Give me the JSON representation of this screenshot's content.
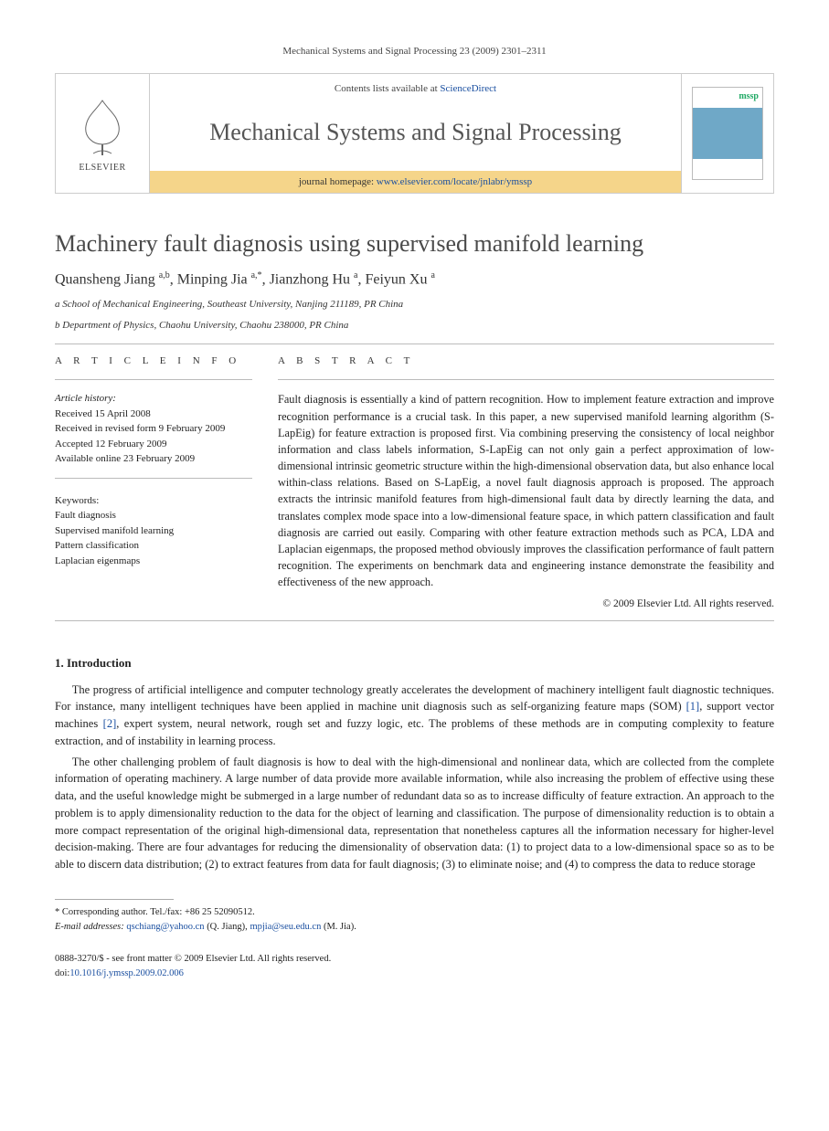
{
  "running_head": "Mechanical Systems and Signal Processing 23 (2009) 2301–2311",
  "header": {
    "contents_prefix": "Contents lists available at ",
    "contents_link": "ScienceDirect",
    "journal_name": "Mechanical Systems and Signal Processing",
    "homepage_prefix": "journal homepage: ",
    "homepage_link": "www.elsevier.com/locate/jnlabr/ymssp",
    "publisher_label": "ELSEVIER",
    "cover_label": "mssp"
  },
  "title": "Machinery fault diagnosis using supervised manifold learning",
  "authors_html": "Quansheng Jiang <sup>a,b</sup>, Minping Jia <sup>a,*</sup>, Jianzhong Hu <sup>a</sup>, Feiyun Xu <sup>a</sup>",
  "affiliations": {
    "a": "a School of Mechanical Engineering, Southeast University, Nanjing 211189, PR China",
    "b": "b Department of Physics, Chaohu University, Chaohu 238000, PR China"
  },
  "article_info": {
    "heading": "A R T I C L E   I N F O",
    "history_label": "Article history:",
    "received": "Received 15 April 2008",
    "revised": "Received in revised form 9 February 2009",
    "accepted": "Accepted 12 February 2009",
    "online": "Available online 23 February 2009",
    "keywords_label": "Keywords:",
    "keywords": [
      "Fault diagnosis",
      "Supervised manifold learning",
      "Pattern classification",
      "Laplacian eigenmaps"
    ]
  },
  "abstract": {
    "heading": "A B S T R A C T",
    "text": "Fault diagnosis is essentially a kind of pattern recognition. How to implement feature extraction and improve recognition performance is a crucial task. In this paper, a new supervised manifold learning algorithm (S-LapEig) for feature extraction is proposed first. Via combining preserving the consistency of local neighbor information and class labels information, S-LapEig can not only gain a perfect approximation of low-dimensional intrinsic geometric structure within the high-dimensional observation data, but also enhance local within-class relations. Based on S-LapEig, a novel fault diagnosis approach is proposed. The approach extracts the intrinsic manifold features from high-dimensional fault data by directly learning the data, and translates complex mode space into a low-dimensional feature space, in which pattern classification and fault diagnosis are carried out easily. Comparing with other feature extraction methods such as PCA, LDA and Laplacian eigenmaps, the proposed method obviously improves the classification performance of fault pattern recognition. The experiments on benchmark data and engineering instance demonstrate the feasibility and effectiveness of the new approach.",
    "copyright": "© 2009 Elsevier Ltd. All rights reserved."
  },
  "section1": {
    "heading": "1. Introduction",
    "para1_pre": "The progress of artificial intelligence and computer technology greatly accelerates the development of machinery intelligent fault diagnostic techniques. For instance, many intelligent techniques have been applied in machine unit diagnosis such as self-organizing feature maps (SOM) ",
    "ref1": "[1]",
    "para1_mid": ", support vector machines ",
    "ref2": "[2]",
    "para1_post": ", expert system, neural network, rough set and fuzzy logic, etc. The problems of these methods are in computing complexity to feature extraction, and of instability in learning process.",
    "para2": "The other challenging problem of fault diagnosis is how to deal with the high-dimensional and nonlinear data, which are collected from the complete information of operating machinery. A large number of data provide more available information, while also increasing the problem of effective using these data, and the useful knowledge might be submerged in a large number of redundant data so as to increase difficulty of feature extraction. An approach to the problem is to apply dimensionality reduction to the data for the object of learning and classification. The purpose of dimensionality reduction is to obtain a more compact representation of the original high-dimensional data, representation that nonetheless captures all the information necessary for higher-level decision-making. There are four advantages for reducing the dimensionality of observation data: (1) to project data to a low-dimensional space so as to be able to discern data distribution; (2) to extract features from data for fault diagnosis; (3) to eliminate noise; and (4) to compress the data to reduce storage"
  },
  "footnote": {
    "corr": "* Corresponding author. Tel./fax: +86 25 52090512.",
    "email_label": "E-mail addresses:",
    "email1": "qschiang@yahoo.cn",
    "email1_who": "(Q. Jiang),",
    "email2": "mpjia@seu.edu.cn",
    "email2_who": "(M. Jia)."
  },
  "bottom": {
    "issn_line": "0888-3270/$ - see front matter © 2009 Elsevier Ltd. All rights reserved.",
    "doi_label": "doi:",
    "doi": "10.1016/j.ymssp.2009.02.006"
  }
}
